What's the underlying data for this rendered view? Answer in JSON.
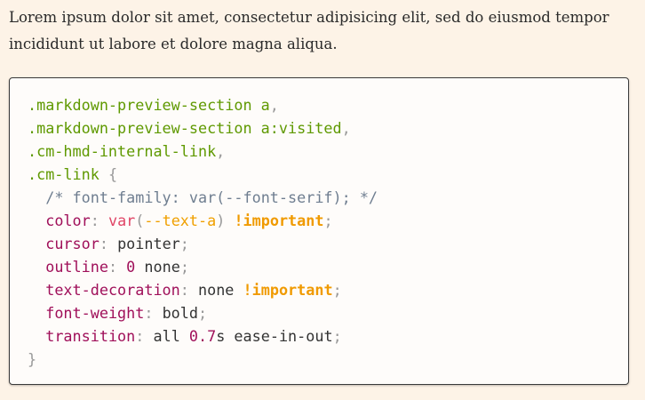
{
  "paragraph": "Lorem ipsum dolor sit amet, consectetur adipisicing elit, sed do eiusmod tempor incididunt ut labore et dolore magna aliqua.",
  "code_lines": [
    [
      [
        "sel",
        ".markdown-preview-section a"
      ],
      [
        "pun",
        ","
      ]
    ],
    [
      [
        "sel",
        ".markdown-preview-section a:visited"
      ],
      [
        "pun",
        ","
      ]
    ],
    [
      [
        "sel",
        ".cm-hmd-internal-link"
      ],
      [
        "pun",
        ","
      ]
    ],
    [
      [
        "sel",
        ".cm-link "
      ],
      [
        "pun",
        "{"
      ]
    ],
    [
      [
        "val",
        "  "
      ],
      [
        "cmt",
        "/* font-family: var(--font-serif); */"
      ]
    ],
    [
      [
        "val",
        "  "
      ],
      [
        "prop",
        "color"
      ],
      [
        "pun",
        ": "
      ],
      [
        "fn",
        "var"
      ],
      [
        "pun",
        "("
      ],
      [
        "var",
        "--text-a"
      ],
      [
        "pun",
        ") "
      ],
      [
        "imp",
        "!important"
      ],
      [
        "pun",
        ";"
      ]
    ],
    [
      [
        "val",
        "  "
      ],
      [
        "prop",
        "cursor"
      ],
      [
        "pun",
        ": "
      ],
      [
        "val",
        "pointer"
      ],
      [
        "pun",
        ";"
      ]
    ],
    [
      [
        "val",
        "  "
      ],
      [
        "prop",
        "outline"
      ],
      [
        "pun",
        ": "
      ],
      [
        "num",
        "0"
      ],
      [
        "val",
        " none"
      ],
      [
        "pun",
        ";"
      ]
    ],
    [
      [
        "val",
        "  "
      ],
      [
        "prop",
        "text-decoration"
      ],
      [
        "pun",
        ": "
      ],
      [
        "val",
        "none "
      ],
      [
        "imp",
        "!important"
      ],
      [
        "pun",
        ";"
      ]
    ],
    [
      [
        "val",
        "  "
      ],
      [
        "prop",
        "font-weight"
      ],
      [
        "pun",
        ": "
      ],
      [
        "val",
        "bold"
      ],
      [
        "pun",
        ";"
      ]
    ],
    [
      [
        "val",
        "  "
      ],
      [
        "prop",
        "transition"
      ],
      [
        "pun",
        ": "
      ],
      [
        "val",
        "all "
      ],
      [
        "num",
        "0.7"
      ],
      [
        "val",
        "s ease-in-out"
      ],
      [
        "pun",
        ";"
      ]
    ],
    [
      [
        "pun",
        "}"
      ]
    ]
  ]
}
